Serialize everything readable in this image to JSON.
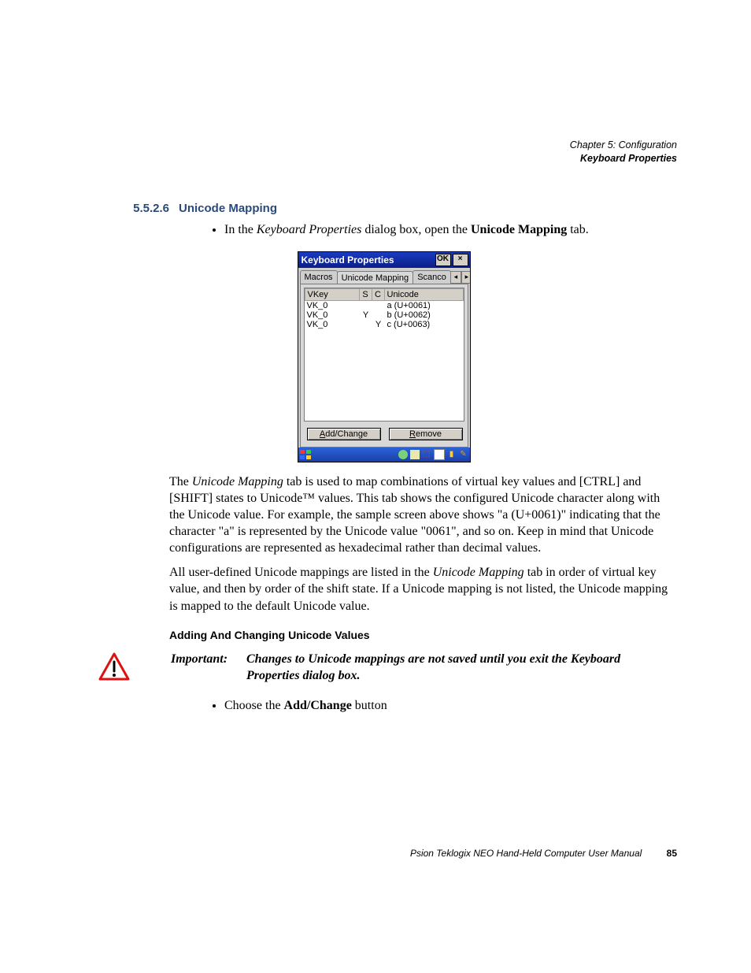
{
  "header": {
    "chapter": "Chapter 5: Configuration",
    "section": "Keyboard Properties"
  },
  "section": {
    "number": "5.5.2.6",
    "title": "Unicode Mapping"
  },
  "intro": {
    "bullet_pre": "In the ",
    "bullet_em": "Keyboard Properties",
    "bullet_mid": " dialog box, open the ",
    "bullet_bold": "Unicode Mapping",
    "bullet_post": " tab."
  },
  "dialog": {
    "title": "Keyboard Properties",
    "ok": "OK",
    "close": "×",
    "tabs": {
      "macros": "Macros",
      "unicode": "Unicode Mapping",
      "scancode": "Scanco"
    },
    "columns": {
      "vkey": "VKey",
      "s": "S",
      "c": "C",
      "unicode": "Unicode"
    },
    "rows": [
      {
        "vkey": "VK_0",
        "s": "",
        "c": "",
        "unicode": "a (U+0061)"
      },
      {
        "vkey": "VK_0",
        "s": "Y",
        "c": "",
        "unicode": "b (U+0062)"
      },
      {
        "vkey": "VK_0",
        "s": "",
        "c": "Y",
        "unicode": "c (U+0063)"
      }
    ],
    "buttons": {
      "add_a": "A",
      "add_rest": "dd/Change",
      "rem_r": "R",
      "rem_rest": "emove"
    }
  },
  "para1": {
    "t1": "The ",
    "em1": "Unicode Mapping",
    "t2": " tab is used to map combinations of virtual key values and [CTRL] and [SHIFT] states to Unicode™ values. This tab shows the configured Unicode character along with the Unicode value. For example, the sample screen above shows \"a (U+0061)\" indicating that the character \"a\" is represented by the Unicode value \"0061\", and so on. Keep in mind that Unicode configurations are represented as hexadecimal rather than decimal values."
  },
  "para2": {
    "t1": "All user-defined Unicode mappings are listed in the ",
    "em1": "Unicode Mapping",
    "t2": " tab in order of virtual key value, and then by order of the shift state. If a Unicode mapping is not listed, the Unicode mapping is mapped to the default Unicode value."
  },
  "subhead": "Adding And Changing Unicode Values",
  "important": {
    "label": "Important:",
    "line1": "Changes to Unicode mappings are not saved until you exit the Keyboard",
    "line2": "Properties dialog box."
  },
  "bullet2": {
    "t1": "Choose the ",
    "b1": "Add/Change",
    "t2": " button"
  },
  "footer": {
    "text": "Psion Teklogix NEO Hand-Held Computer User Manual",
    "page": "85"
  }
}
